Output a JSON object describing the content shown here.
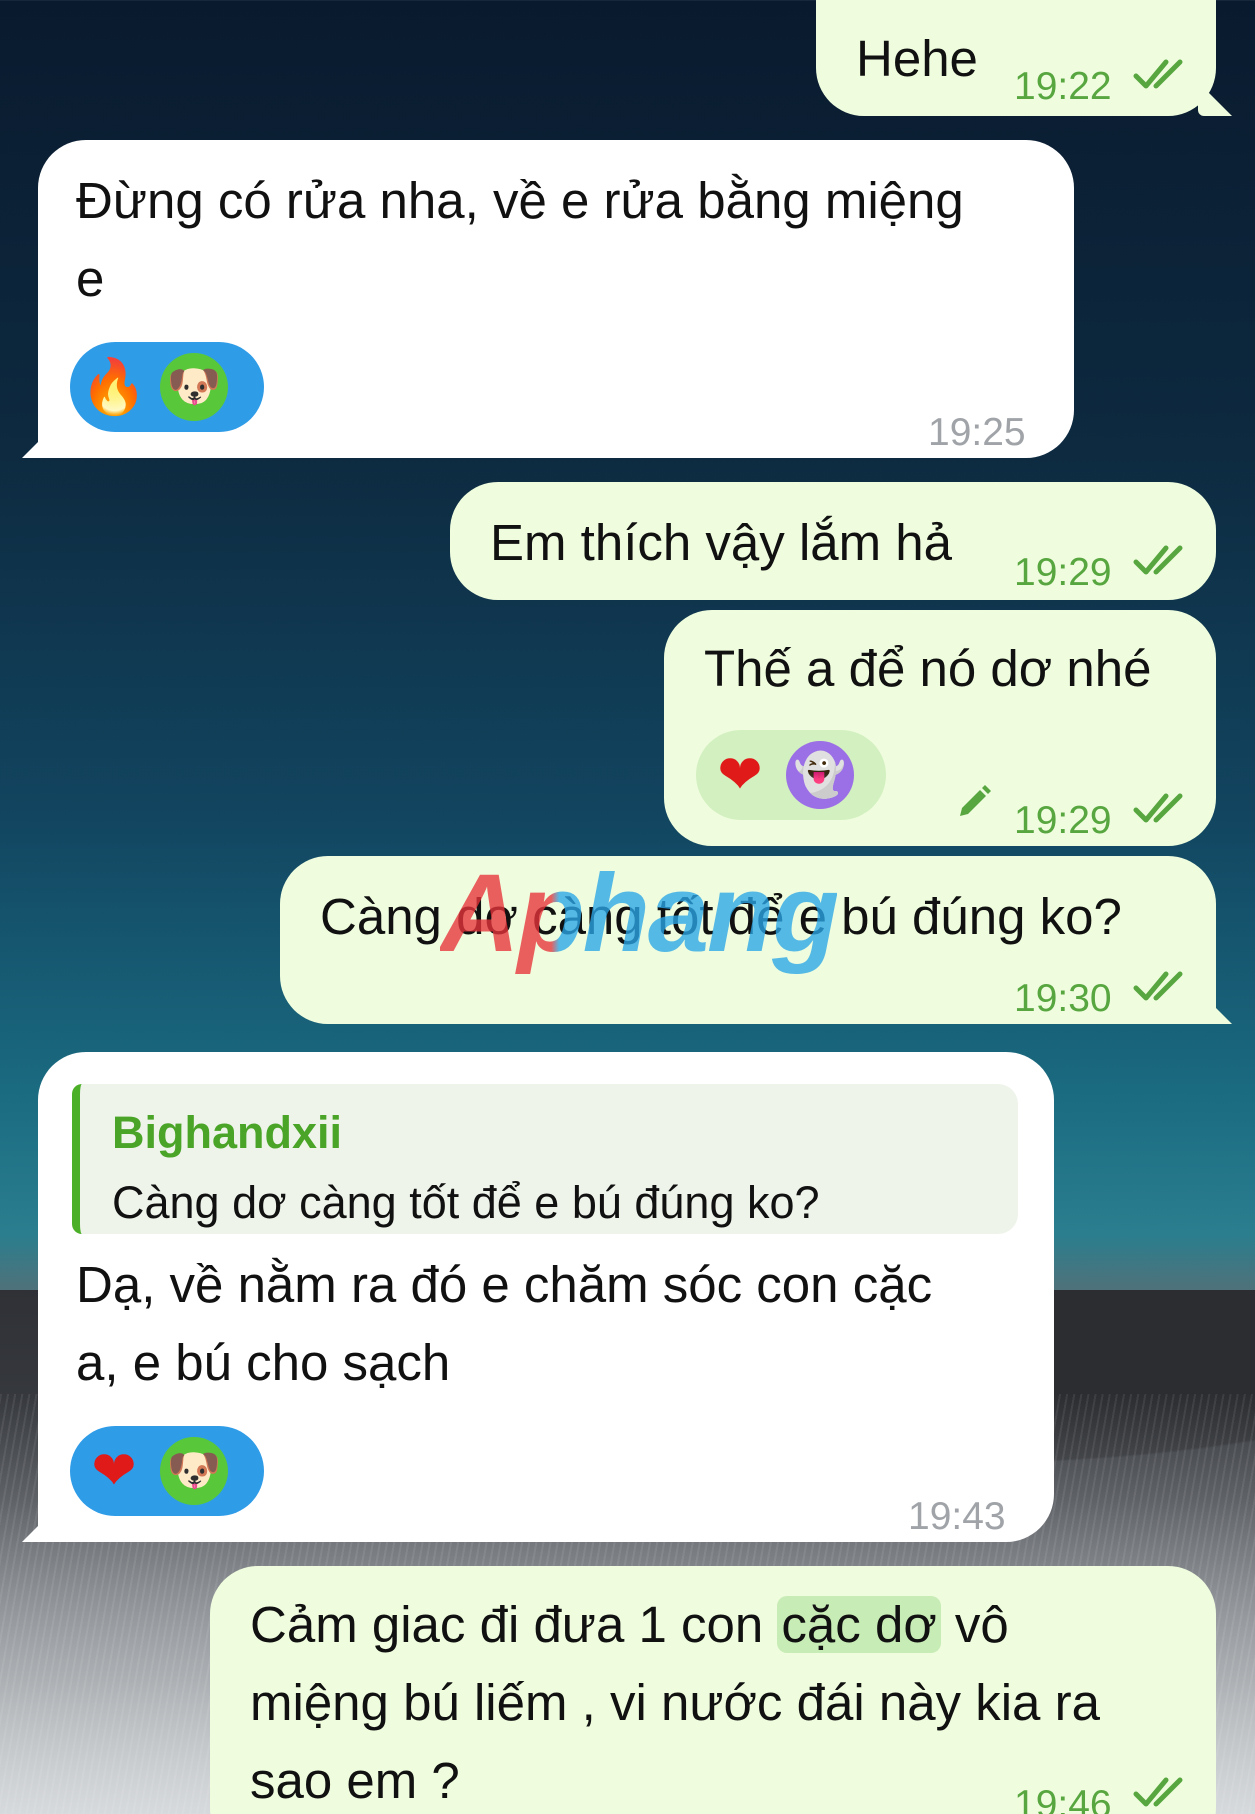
{
  "theme": {
    "outgoing_bg": "#effdde",
    "incoming_bg": "#ffffff",
    "accent_green": "#58a640",
    "reaction_blue": "#2f9ce8"
  },
  "watermark": "Aphang",
  "messages": [
    {
      "id": "m1",
      "side": "out",
      "lines": [
        "Hehe"
      ],
      "time": "19:22",
      "status": "read"
    },
    {
      "id": "m2",
      "side": "in",
      "lines": [
        "Đừng có rửa nha, về e rửa bằng miệng",
        "e"
      ],
      "time": "19:25",
      "reactions": [
        "fire-emoji",
        "dog-face-emoji"
      ],
      "reaction_glyphs": [
        "🔥",
        "🐶"
      ]
    },
    {
      "id": "m3",
      "side": "out",
      "lines": [
        "Em thích vậy lắm hả"
      ],
      "time": "19:29",
      "status": "read"
    },
    {
      "id": "m4",
      "side": "out",
      "lines": [
        "Thế a để nó dơ nhé"
      ],
      "time": "19:29",
      "status": "read",
      "edited": true,
      "reactions": [
        "red-heart-emoji",
        "ghost-emoji"
      ],
      "reaction_glyphs": [
        "❤",
        "👻"
      ]
    },
    {
      "id": "m5",
      "side": "out",
      "lines": [
        "Càng dơ càng tốt để e bú đúng ko?"
      ],
      "time": "19:30",
      "status": "read"
    },
    {
      "id": "m6",
      "side": "in",
      "reply": {
        "author": "Bighandxii",
        "text": "Càng dơ càng tốt để e bú đúng ko?"
      },
      "lines": [
        "Dạ, về nằm ra đó e chăm sóc con cặc",
        "a, e bú cho sạch"
      ],
      "time": "19:43",
      "reactions": [
        "red-heart-emoji",
        "dog-face-emoji"
      ],
      "reaction_glyphs": [
        "❤",
        "🐶"
      ]
    },
    {
      "id": "m7",
      "side": "out",
      "line1_before": "Cảm giac đi đưa 1 con ",
      "line1_highlight": "cặc dơ",
      "line1_after": " vô",
      "lines": [
        "miệng bú liếm , vi nước đái này kia ra",
        "sao em ?"
      ],
      "time": "19:46",
      "status": "read"
    }
  ]
}
